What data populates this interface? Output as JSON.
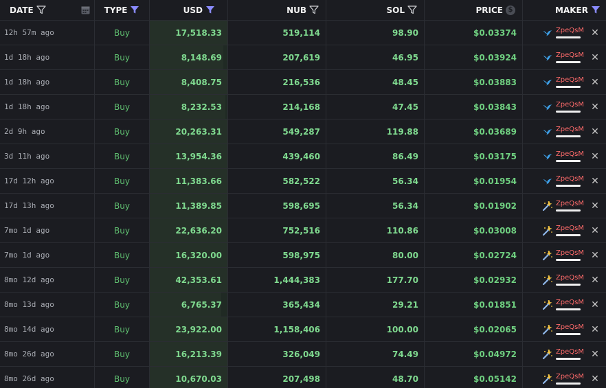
{
  "headers": {
    "date": "DATE",
    "type": "TYPE",
    "usd": "USD",
    "nub": "NUB",
    "sol": "SOL",
    "price": "PRICE",
    "maker": "MAKER"
  },
  "filter_states": {
    "date": "inactive",
    "type": "active",
    "usd": "active",
    "nub": "inactive",
    "sol": "inactive",
    "maker": "active"
  },
  "colors": {
    "buy": "#5fbf70",
    "value_green": "#7fd98f",
    "maker_red": "#ff6b6b",
    "filter_active": "#8b8cff",
    "row_border": "#2b2d33"
  },
  "price_icon": "dollar-circle-icon",
  "calendar_icon": "calendar-icon",
  "rows": [
    {
      "date": "12h 57m ago",
      "type": "Buy",
      "usd": "17,518.33",
      "nub": "519,114",
      "sol": "98.90",
      "price": "$0.03374",
      "maker": "ZpeQsM",
      "maker_icon": "bird-icon",
      "usd_fill": 1.0
    },
    {
      "date": "1d 18h ago",
      "type": "Buy",
      "usd": "8,148.69",
      "nub": "207,619",
      "sol": "46.95",
      "price": "$0.03924",
      "maker": "ZpeQsM",
      "maker_icon": "bird-icon",
      "usd_fill": 0.95
    },
    {
      "date": "1d 18h ago",
      "type": "Buy",
      "usd": "8,408.75",
      "nub": "216,536",
      "sol": "48.45",
      "price": "$0.03883",
      "maker": "ZpeQsM",
      "maker_icon": "bird-icon",
      "usd_fill": 1.0
    },
    {
      "date": "1d 18h ago",
      "type": "Buy",
      "usd": "8,232.53",
      "nub": "214,168",
      "sol": "47.45",
      "price": "$0.03843",
      "maker": "ZpeQsM",
      "maker_icon": "bird-icon",
      "usd_fill": 0.97
    },
    {
      "date": "2d 9h ago",
      "type": "Buy",
      "usd": "20,263.31",
      "nub": "549,287",
      "sol": "119.88",
      "price": "$0.03689",
      "maker": "ZpeQsM",
      "maker_icon": "bird-icon",
      "usd_fill": 1.0
    },
    {
      "date": "3d 11h ago",
      "type": "Buy",
      "usd": "13,954.36",
      "nub": "439,460",
      "sol": "86.49",
      "price": "$0.03175",
      "maker": "ZpeQsM",
      "maker_icon": "bird-icon",
      "usd_fill": 1.0
    },
    {
      "date": "17d 12h ago",
      "type": "Buy",
      "usd": "11,383.66",
      "nub": "582,522",
      "sol": "56.34",
      "price": "$0.01954",
      "maker": "ZpeQsM",
      "maker_icon": "bird-icon",
      "usd_fill": 1.0
    },
    {
      "date": "17d 13h ago",
      "type": "Buy",
      "usd": "11,389.85",
      "nub": "598,695",
      "sol": "56.34",
      "price": "$0.01902",
      "maker": "ZpeQsM",
      "maker_icon": "wand-icon",
      "usd_fill": 1.0
    },
    {
      "date": "7mo 1d ago",
      "type": "Buy",
      "usd": "22,636.20",
      "nub": "752,516",
      "sol": "110.86",
      "price": "$0.03008",
      "maker": "ZpeQsM",
      "maker_icon": "wand-icon",
      "usd_fill": 1.0
    },
    {
      "date": "7mo 1d ago",
      "type": "Buy",
      "usd": "16,320.00",
      "nub": "598,975",
      "sol": "80.00",
      "price": "$0.02724",
      "maker": "ZpeQsM",
      "maker_icon": "wand-icon",
      "usd_fill": 1.0
    },
    {
      "date": "8mo 12d ago",
      "type": "Buy",
      "usd": "42,353.61",
      "nub": "1,444,383",
      "sol": "177.70",
      "price": "$0.02932",
      "maker": "ZpeQsM",
      "maker_icon": "wand-icon",
      "usd_fill": 1.0
    },
    {
      "date": "8mo 13d ago",
      "type": "Buy",
      "usd": "6,765.37",
      "nub": "365,434",
      "sol": "29.21",
      "price": "$0.01851",
      "maker": "ZpeQsM",
      "maker_icon": "wand-icon",
      "usd_fill": 0.92
    },
    {
      "date": "8mo 14d ago",
      "type": "Buy",
      "usd": "23,922.00",
      "nub": "1,158,406",
      "sol": "100.00",
      "price": "$0.02065",
      "maker": "ZpeQsM",
      "maker_icon": "wand-icon",
      "usd_fill": 1.0
    },
    {
      "date": "8mo 26d ago",
      "type": "Buy",
      "usd": "16,213.39",
      "nub": "326,049",
      "sol": "74.49",
      "price": "$0.04972",
      "maker": "ZpeQsM",
      "maker_icon": "wand-icon",
      "usd_fill": 1.0
    },
    {
      "date": "8mo 26d ago",
      "type": "Buy",
      "usd": "10,670.03",
      "nub": "207,498",
      "sol": "48.70",
      "price": "$0.05142",
      "maker": "ZpeQsM",
      "maker_icon": "wand-icon",
      "usd_fill": 1.0
    }
  ]
}
